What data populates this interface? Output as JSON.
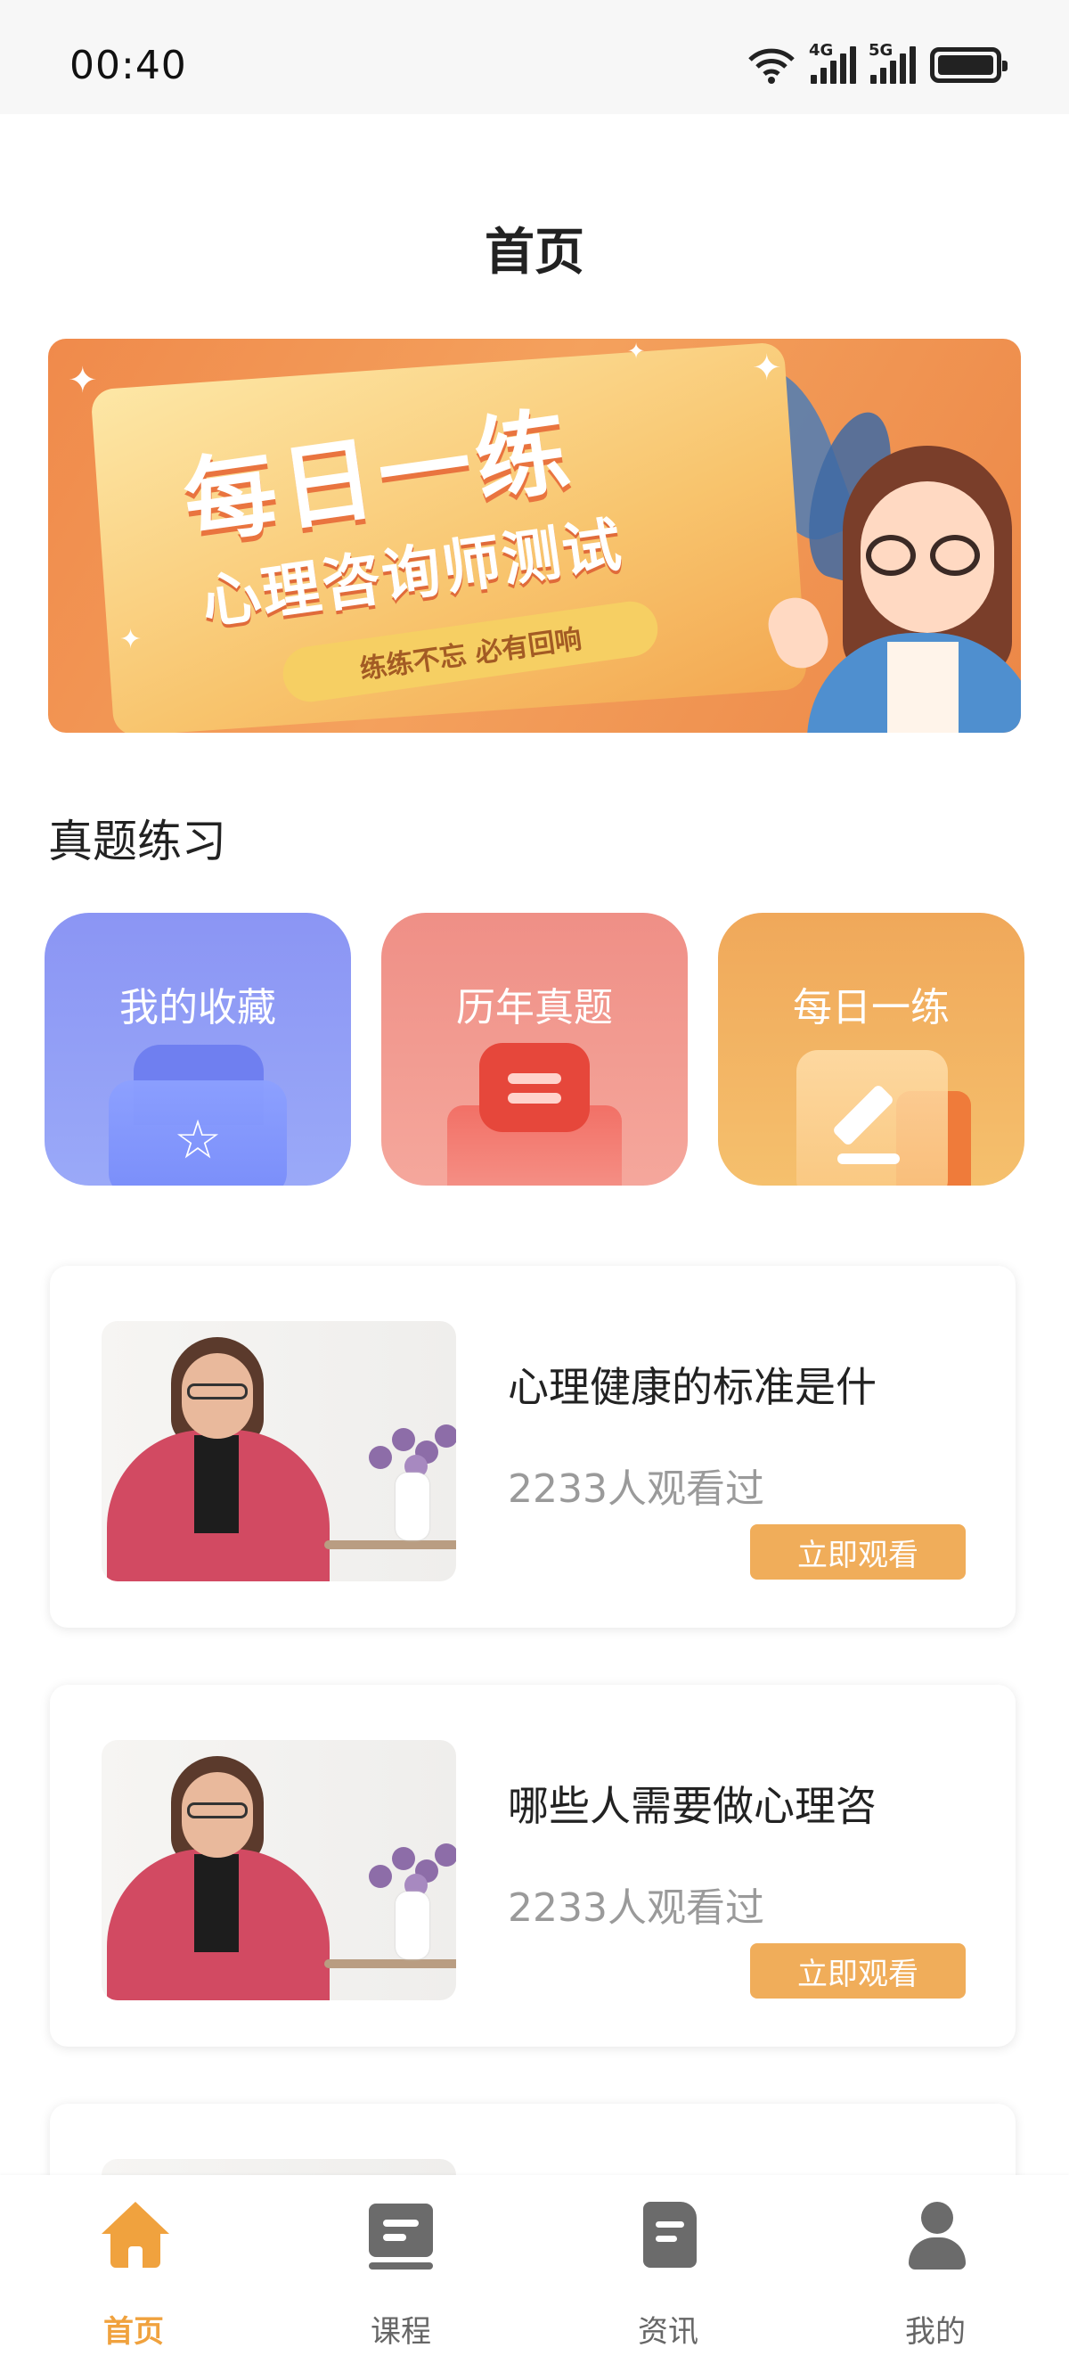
{
  "status_bar": {
    "time": "00:40",
    "network_1": "4G",
    "network_2": "5G"
  },
  "header": {
    "title": "首页"
  },
  "banner": {
    "headline": "每日一练",
    "subtitle": "心理咨询师测试",
    "slogan": "练练不忘 必有回响"
  },
  "section": {
    "title": "真题练习"
  },
  "categories": [
    {
      "label": "我的收藏",
      "icon": "folder-star-icon",
      "color": "#8b95f4"
    },
    {
      "label": "历年真题",
      "icon": "document-icon",
      "color": "#ef8f86"
    },
    {
      "label": "每日一练",
      "icon": "note-edit-icon",
      "color": "#f0a85a"
    }
  ],
  "courses": [
    {
      "title": "心理健康的标准是什",
      "views": "2233人观看过",
      "button": "立即观看"
    },
    {
      "title": "哪些人需要做心理咨",
      "views": "2233人观看过",
      "button": "立即观看"
    },
    {
      "title": "",
      "views": "",
      "button": ""
    }
  ],
  "bottom_nav": {
    "items": [
      {
        "label": "首页",
        "icon": "home-icon",
        "active": true
      },
      {
        "label": "课程",
        "icon": "course-icon",
        "active": false
      },
      {
        "label": "资讯",
        "icon": "news-icon",
        "active": false
      },
      {
        "label": "我的",
        "icon": "profile-icon",
        "active": false
      }
    ],
    "active_color": "#f0a23e",
    "inactive_color": "#666666"
  },
  "colors": {
    "accent": "#f0ad5a",
    "banner": "#f08a4b"
  }
}
